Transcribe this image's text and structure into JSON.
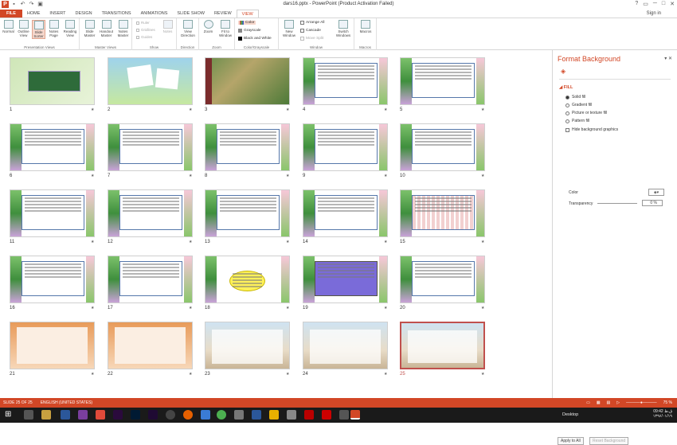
{
  "window": {
    "title": "dars16.pptx - PowerPoint (Product Activation Failed)",
    "signin": "Sign in",
    "help": "?"
  },
  "tabs": [
    "FILE",
    "HOME",
    "INSERT",
    "DESIGN",
    "TRANSITIONS",
    "ANIMATIONS",
    "SLIDE SHOW",
    "REVIEW",
    "VIEW"
  ],
  "active_tab": "VIEW",
  "ribbon": {
    "presentation_views": {
      "label": "Presentation Views",
      "items": [
        "Normal",
        "Outline View",
        "Slide Sorter",
        "Notes Page",
        "Reading View"
      ]
    },
    "master_views": {
      "label": "Master Views",
      "items": [
        "Slide Master",
        "Handout Master",
        "Notes Master"
      ]
    },
    "show": {
      "label": "Show",
      "items": [
        "Ruler",
        "Gridlines",
        "Guides"
      ],
      "notes": "Notes"
    },
    "direction": {
      "label": "Direction",
      "item": "View Direction"
    },
    "zoom": {
      "label": "Zoom",
      "items": [
        "Zoom",
        "Fit to Window"
      ]
    },
    "color": {
      "label": "Color/Grayscale",
      "items": [
        "Color",
        "Grayscale",
        "Black and White"
      ]
    },
    "window": {
      "label": "Window",
      "items": [
        "New Window",
        "Arrange All",
        "Cascade",
        "Move Split",
        "Switch Windows"
      ]
    },
    "macros": {
      "label": "Macros",
      "item": "Macros"
    }
  },
  "slides": [
    {
      "num": "1",
      "kind": "title"
    },
    {
      "num": "2",
      "kind": "cartoon"
    },
    {
      "num": "3",
      "kind": "photo"
    },
    {
      "num": "4",
      "kind": "text"
    },
    {
      "num": "5",
      "kind": "text"
    },
    {
      "num": "6",
      "kind": "text"
    },
    {
      "num": "7",
      "kind": "text"
    },
    {
      "num": "8",
      "kind": "text"
    },
    {
      "num": "9",
      "kind": "text"
    },
    {
      "num": "10",
      "kind": "text"
    },
    {
      "num": "11",
      "kind": "text"
    },
    {
      "num": "12",
      "kind": "text"
    },
    {
      "num": "13",
      "kind": "text"
    },
    {
      "num": "14",
      "kind": "text"
    },
    {
      "num": "15",
      "kind": "grid"
    },
    {
      "num": "16",
      "kind": "text"
    },
    {
      "num": "17",
      "kind": "text"
    },
    {
      "num": "18",
      "kind": "yellow"
    },
    {
      "num": "19",
      "kind": "purple"
    },
    {
      "num": "20",
      "kind": "text"
    },
    {
      "num": "21",
      "kind": "orange"
    },
    {
      "num": "22",
      "kind": "orange"
    },
    {
      "num": "23",
      "kind": "landscape"
    },
    {
      "num": "24",
      "kind": "landscape"
    },
    {
      "num": "25",
      "kind": "landscape"
    }
  ],
  "selected_slide": "25",
  "pane": {
    "title": "Format Background",
    "section": "FILL",
    "options": [
      "Solid fill",
      "Gradient fill",
      "Picture or texture fill",
      "Pattern fill"
    ],
    "selected_option": "Solid fill",
    "hide_graphics": "Hide background graphics",
    "color_label": "Color",
    "transparency_label": "Transparency",
    "transparency_value": "0 %",
    "apply_all": "Apply to All",
    "reset": "Reset Background"
  },
  "status": {
    "slide": "SLIDE 25 OF 25",
    "language": "ENGLISH (UNITED STATES)",
    "zoom": "75 %"
  },
  "taskbar": {
    "desktop": "Desktop",
    "time": "09:42 ق.ظ",
    "date": "۱۳۹۶/۰۱/۱۹"
  }
}
